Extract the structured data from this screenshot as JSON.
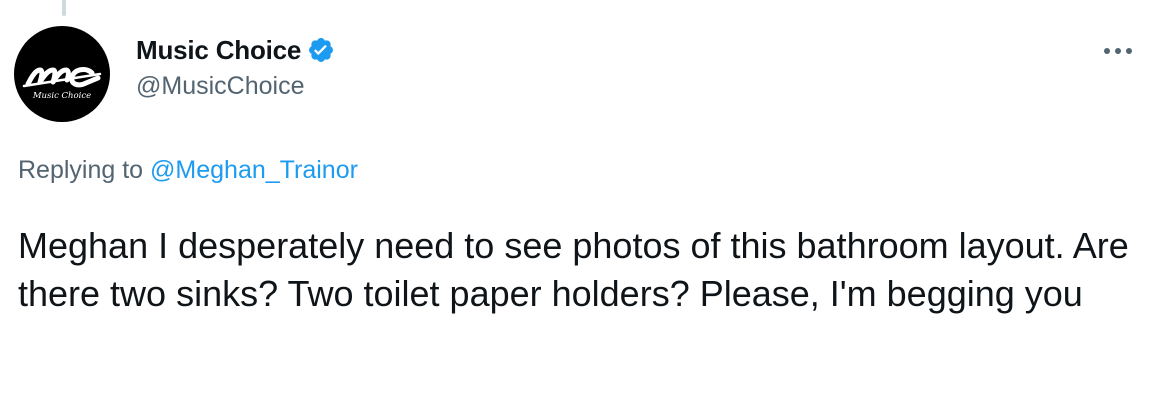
{
  "tweet": {
    "author": {
      "display_name": "Music Choice",
      "handle": "@MusicChoice",
      "verified": true,
      "avatar_monogram": "mc",
      "avatar_caption": "Music Choice"
    },
    "reply": {
      "prefix": "Replying to ",
      "mention": "@Meghan_Trainor"
    },
    "text": "Meghan I desperately need to see photos of this bathroom layout. Are there two sinks? Two toilet paper holders? Please, I'm begging you"
  },
  "icons": {
    "verified": "verified-badge-icon",
    "more": "more-options-icon"
  },
  "colors": {
    "accent": "#1d9bf0",
    "secondary_text": "#536471",
    "primary_text": "#0f1419",
    "thread_line": "#cfd9de",
    "avatar_bg": "#000000"
  }
}
